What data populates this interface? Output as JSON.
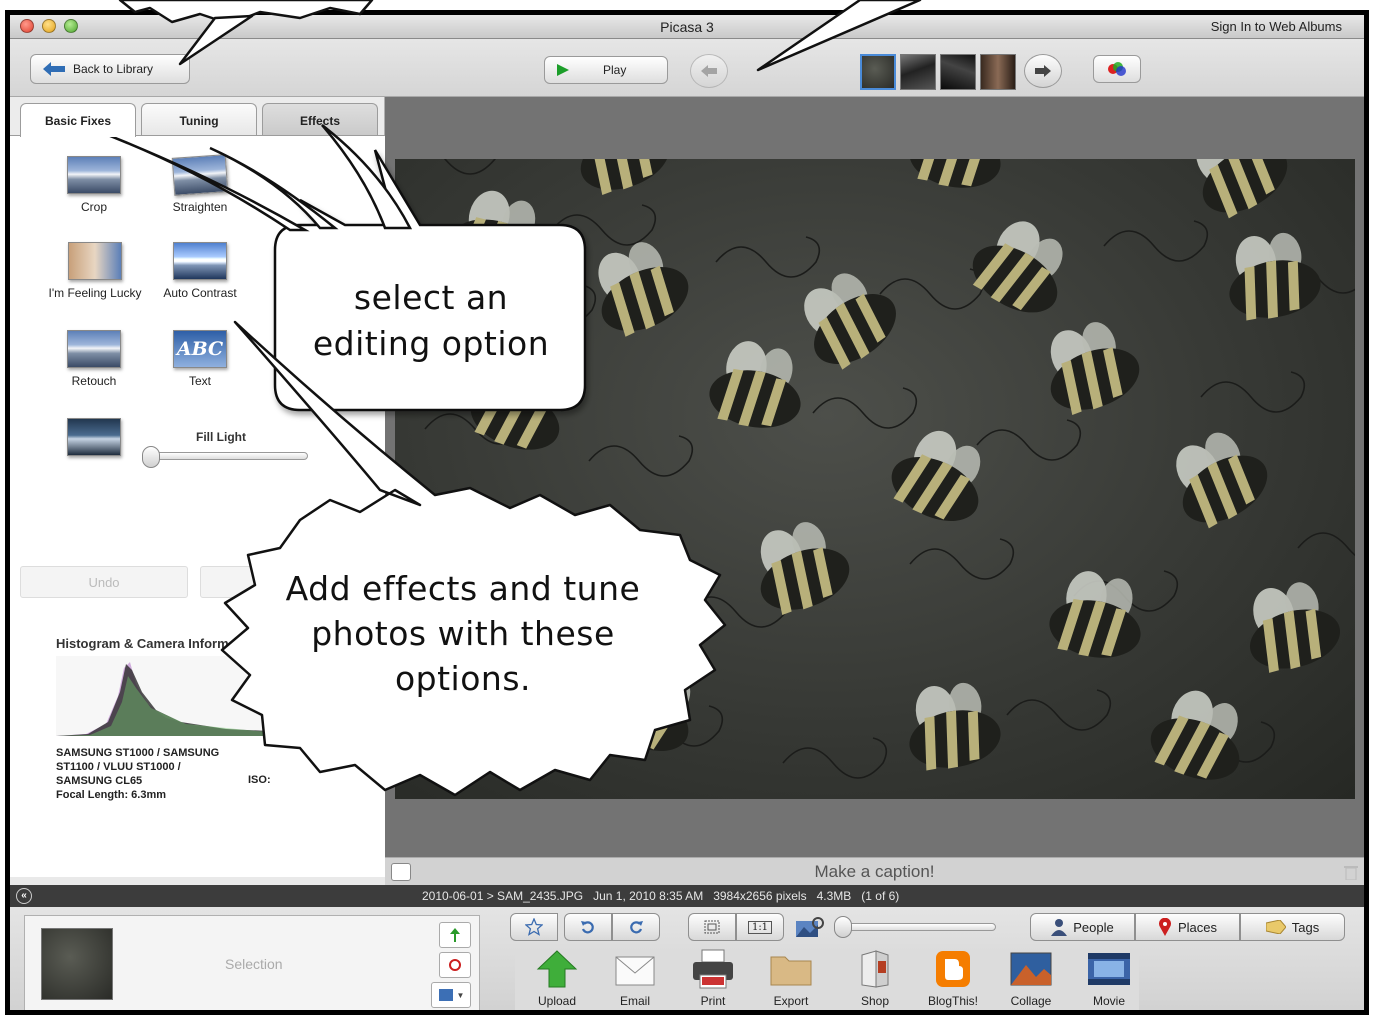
{
  "window": {
    "title": "Picasa 3",
    "sign_in": "Sign In to Web Albums"
  },
  "toolbar": {
    "back_label": "Back to Library",
    "play_label": "Play"
  },
  "left_panel": {
    "tabs": [
      {
        "label": "Basic Fixes"
      },
      {
        "label": "Tuning"
      },
      {
        "label": "Effects"
      }
    ],
    "tools": [
      {
        "label": "Crop"
      },
      {
        "label": "Straighten"
      },
      {
        "label": "I'm Feeling Lucky"
      },
      {
        "label": "Auto Contrast"
      },
      {
        "label": "Retouch"
      },
      {
        "label": "Text"
      }
    ],
    "text_icon_label": "ABC",
    "fill_light_label": "Fill Light",
    "fill_light_value": 0,
    "undo_label": "Undo",
    "histogram_title": "Histogram & Camera Information",
    "camera_info": [
      "SAMSUNG ST1000 / SAMSUNG",
      "ST1100 / VLUU ST1000 /",
      "SAMSUNG CL65",
      "Focal Length: 6.3mm"
    ],
    "camera_info_right": "ISO:"
  },
  "photo": {
    "caption_placeholder": "Make a caption!"
  },
  "info_bar": {
    "text": "2010-06-01 > SAM_2435.JPG   Jun 1, 2010 8:35 AM   3984x2656 pixels   4.3MB   (1 of 6)"
  },
  "bottom": {
    "selection_label": "Selection",
    "segments": [
      {
        "label": "People",
        "icon": "person-icon"
      },
      {
        "label": "Places",
        "icon": "map-pin-icon"
      },
      {
        "label": "Tags",
        "icon": "tag-icon"
      }
    ],
    "actions": [
      {
        "label": "Upload",
        "icon": "upload-icon"
      },
      {
        "label": "Email",
        "icon": "email-icon"
      },
      {
        "label": "Print",
        "icon": "print-icon"
      },
      {
        "label": "Export",
        "icon": "folder-icon"
      },
      {
        "label": "Shop",
        "icon": "shop-icon"
      },
      {
        "label": "BlogThis!",
        "icon": "blogger-icon"
      },
      {
        "label": "Collage",
        "icon": "collage-icon"
      },
      {
        "label": "Movie",
        "icon": "movie-icon"
      }
    ],
    "one_to_one_label": "1:1"
  },
  "callouts": {
    "editing": "select an editing option",
    "effects": "Add effects and tune photos with these options."
  },
  "colors": {
    "accent_blue": "#2f6db5",
    "play_green": "#1c9e2a",
    "upload_green": "#3fae3a",
    "blogger_orange": "#f57d00",
    "pin_red": "#cc1f1f"
  }
}
